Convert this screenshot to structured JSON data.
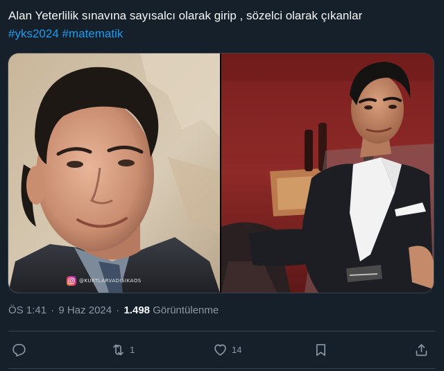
{
  "tweet": {
    "text_line1": "Alan Yeterlilik sınavına sayısalcı olarak girip , sözelci olarak çıkanlar",
    "hashtags": [
      "#yks2024",
      "#matematik"
    ]
  },
  "media": {
    "watermark": "@KURTLARVADISIKAOS"
  },
  "meta": {
    "time": "ÖS 1:41",
    "date": "9 Haz 2024",
    "views_count": "1.498",
    "views_label": "Görüntülenme",
    "separator": "·"
  },
  "actions": {
    "reply_count": "",
    "retweet_count": "1",
    "like_count": "14"
  },
  "colors": {
    "background": "#15202b",
    "text": "#f7f9f9",
    "secondary": "#8b98a5",
    "accent": "#1d9bf0",
    "border": "#38444d"
  },
  "icons": [
    "reply-icon",
    "retweet-icon",
    "like-icon",
    "bookmark-icon",
    "share-icon",
    "instagram-icon"
  ]
}
